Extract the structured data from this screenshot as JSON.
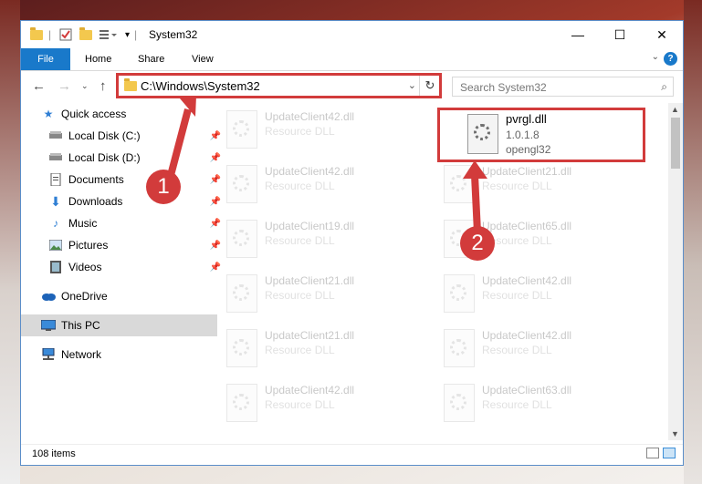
{
  "window": {
    "title": "System32"
  },
  "ribbon": {
    "file": "File",
    "tabs": [
      "Home",
      "Share",
      "View"
    ],
    "help": "?"
  },
  "address": {
    "path": "C:\\Windows\\System32"
  },
  "search": {
    "placeholder": "Search System32"
  },
  "nav": {
    "items": [
      {
        "label": "Quick access",
        "icon": "star-icon",
        "pinned": false
      },
      {
        "label": "Local Disk (C:)",
        "icon": "drive-icon",
        "pinned": true
      },
      {
        "label": "Local Disk (D:)",
        "icon": "drive-icon",
        "pinned": true
      },
      {
        "label": "Documents",
        "icon": "documents-icon",
        "pinned": true
      },
      {
        "label": "Downloads",
        "icon": "download-arrow-icon",
        "pinned": true
      },
      {
        "label": "Music",
        "icon": "music-icon",
        "pinned": true
      },
      {
        "label": "Pictures",
        "icon": "pictures-icon",
        "pinned": true
      },
      {
        "label": "Videos",
        "icon": "videos-icon",
        "pinned": true
      },
      {
        "label": "OneDrive",
        "icon": "cloud-icon",
        "pinned": false
      },
      {
        "label": "This PC",
        "icon": "computer-icon",
        "pinned": false,
        "selected": true
      },
      {
        "label": "Network",
        "icon": "network-icon",
        "pinned": false
      }
    ]
  },
  "files": {
    "highlighted": {
      "name": "pvrgl.dll",
      "version": "1.0.1.8",
      "description": "opengl32"
    },
    "left_column": [
      {
        "name": "UpdateClient42.dll",
        "desc": "Resource DLL"
      },
      {
        "name": "UpdateClient42.dll",
        "desc": "Resource DLL"
      },
      {
        "name": "UpdateClient19.dll",
        "desc": "Resource DLL"
      },
      {
        "name": "UpdateClient21.dll",
        "desc": "Resource DLL"
      },
      {
        "name": "UpdateClient21.dll",
        "desc": "Resource DLL"
      },
      {
        "name": "UpdateClient42.dll",
        "desc": "Resource DLL"
      }
    ],
    "right_column": [
      {
        "name": "UpdateClient21.dll",
        "desc": "Resource DLL"
      },
      {
        "name": "UpdateClient65.dll",
        "desc": "Resource DLL"
      },
      {
        "name": "UpdateClient42.dll",
        "desc": "Resource DLL"
      },
      {
        "name": "UpdateClient42.dll",
        "desc": "Resource DLL"
      },
      {
        "name": "UpdateClient63.dll",
        "desc": "Resource DLL"
      }
    ]
  },
  "status": {
    "count": "108 items"
  },
  "annotations": {
    "badge1": "1",
    "badge2": "2"
  },
  "colors": {
    "accent": "#1979ca",
    "highlight": "#d23b3b",
    "selected": "#d9d9d9"
  }
}
